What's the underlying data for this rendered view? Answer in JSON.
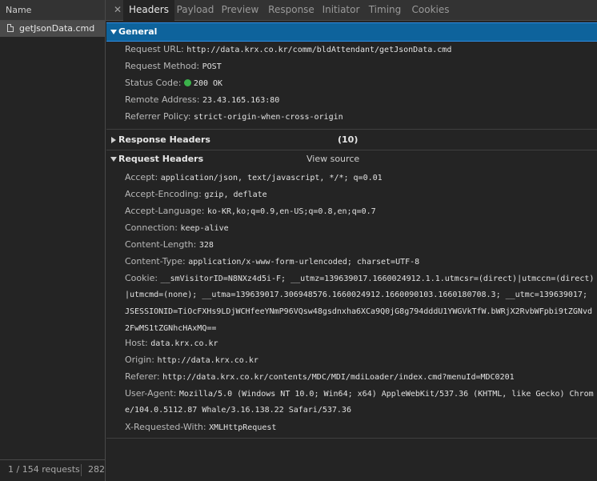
{
  "network": {
    "left": {
      "name_header": "Name",
      "request_name": "getJsonData.cmd",
      "footer_count": "1 / 154 requests",
      "footer_size": "282"
    },
    "tabs": [
      "Headers",
      "Payload",
      "Preview",
      "Response",
      "Initiator",
      "Timing",
      "Cookies"
    ],
    "active_tab": "Headers",
    "general": {
      "title": "General",
      "rows": [
        {
          "key": "Request URL:",
          "value": "http://data.krx.co.kr/comm/bldAttendant/getJsonData.cmd"
        },
        {
          "key": "Request Method:",
          "value": "POST"
        },
        {
          "key": "Status Code:",
          "value": "200 OK"
        },
        {
          "key": "Remote Address:",
          "value": "23.43.165.163:80"
        },
        {
          "key": "Referrer Policy:",
          "value": "strict-origin-when-cross-origin"
        }
      ]
    },
    "response_headers": {
      "title": "Response Headers",
      "count": "(10)"
    },
    "request_headers": {
      "title": "Request Headers",
      "view_source": "View source",
      "rows": [
        {
          "key": "Accept:",
          "value": "application/json, text/javascript, */*; q=0.01"
        },
        {
          "key": "Accept-Encoding:",
          "value": "gzip, deflate"
        },
        {
          "key": "Accept-Language:",
          "value": "ko-KR,ko;q=0.9,en-US;q=0.8,en;q=0.7"
        },
        {
          "key": "Connection:",
          "value": "keep-alive"
        },
        {
          "key": "Content-Length:",
          "value": "328"
        },
        {
          "key": "Content-Type:",
          "value": "application/x-www-form-urlencoded; charset=UTF-8"
        },
        {
          "key": "Cookie:",
          "value": "__smVisitorID=N8NXz4d5i-F; __utmz=139639017.1660024912.1.1.utmcsr=(direct)|utmccn=(direct)",
          "cont": [
            "|utmcmd=(none); __utma=139639017.306948576.1660024912.1660090103.1660180708.3; __utmc=139639017;",
            "JSESSIONID=TiOcFXHs9LDjWCHfeeYNmP96VQsw48gsdnxha6XCa9Q0jG8g794dddU1YWGVkTfW.bWRjX2RvbWFpbi9tZGNvd",
            "2FwMS1tZGNhcHAxMQ=="
          ]
        },
        {
          "key": "Host:",
          "value": "data.krx.co.kr"
        },
        {
          "key": "Origin:",
          "value": "http://data.krx.co.kr"
        },
        {
          "key": "Referer:",
          "value": "http://data.krx.co.kr/contents/MDC/MDI/mdiLoader/index.cmd?menuId=MDC0201"
        },
        {
          "key": "User-Agent:",
          "value": "Mozilla/5.0 (Windows NT 10.0; Win64; x64) AppleWebKit/537.36 (KHTML, like Gecko) Chrom",
          "cont": [
            "e/104.0.5112.87 Whale/3.16.138.22 Safari/537.36"
          ]
        },
        {
          "key": "X-Requested-With:",
          "value": "XMLHttpRequest"
        }
      ]
    },
    "colors": {
      "panel_bg": "#242424",
      "toolbar_bg": "#333333",
      "selected_row": "#4a4a4a",
      "general_header": "#0e639c",
      "status_ok": "#3bb24b"
    }
  }
}
